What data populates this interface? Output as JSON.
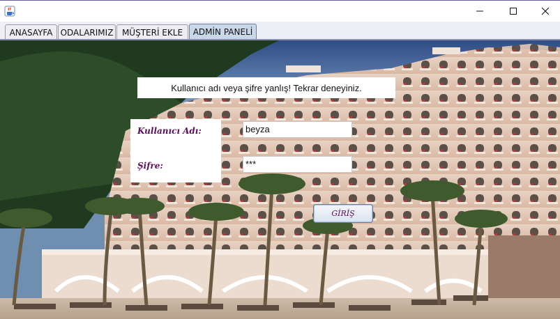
{
  "window": {
    "icon": "java-cup-icon",
    "controls": [
      "minimize-icon",
      "maximize-icon",
      "close-icon"
    ]
  },
  "tabs": [
    {
      "label": "ANASAYFA",
      "active": false
    },
    {
      "label": "ODALARIMIZ",
      "active": false
    },
    {
      "label": "MÜŞTERİ EKLE",
      "active": false
    },
    {
      "label": "ADMİN PANELİ",
      "active": true
    }
  ],
  "login": {
    "message": "Kullanıcı adı veya şifre yanlış! Tekrar deneyiniz.",
    "username_label": "Kullanıcı Adı:",
    "username_value": "beyza",
    "password_label": "Şifre:",
    "password_value": "***",
    "submit_label": "GİRİŞ"
  },
  "colors": {
    "label_color": "#5a0f5a",
    "active_tab": "#c8d8ea",
    "title_accent": "#6b5aa8"
  },
  "background": {
    "description_icon": "hotel-resort-photo"
  }
}
